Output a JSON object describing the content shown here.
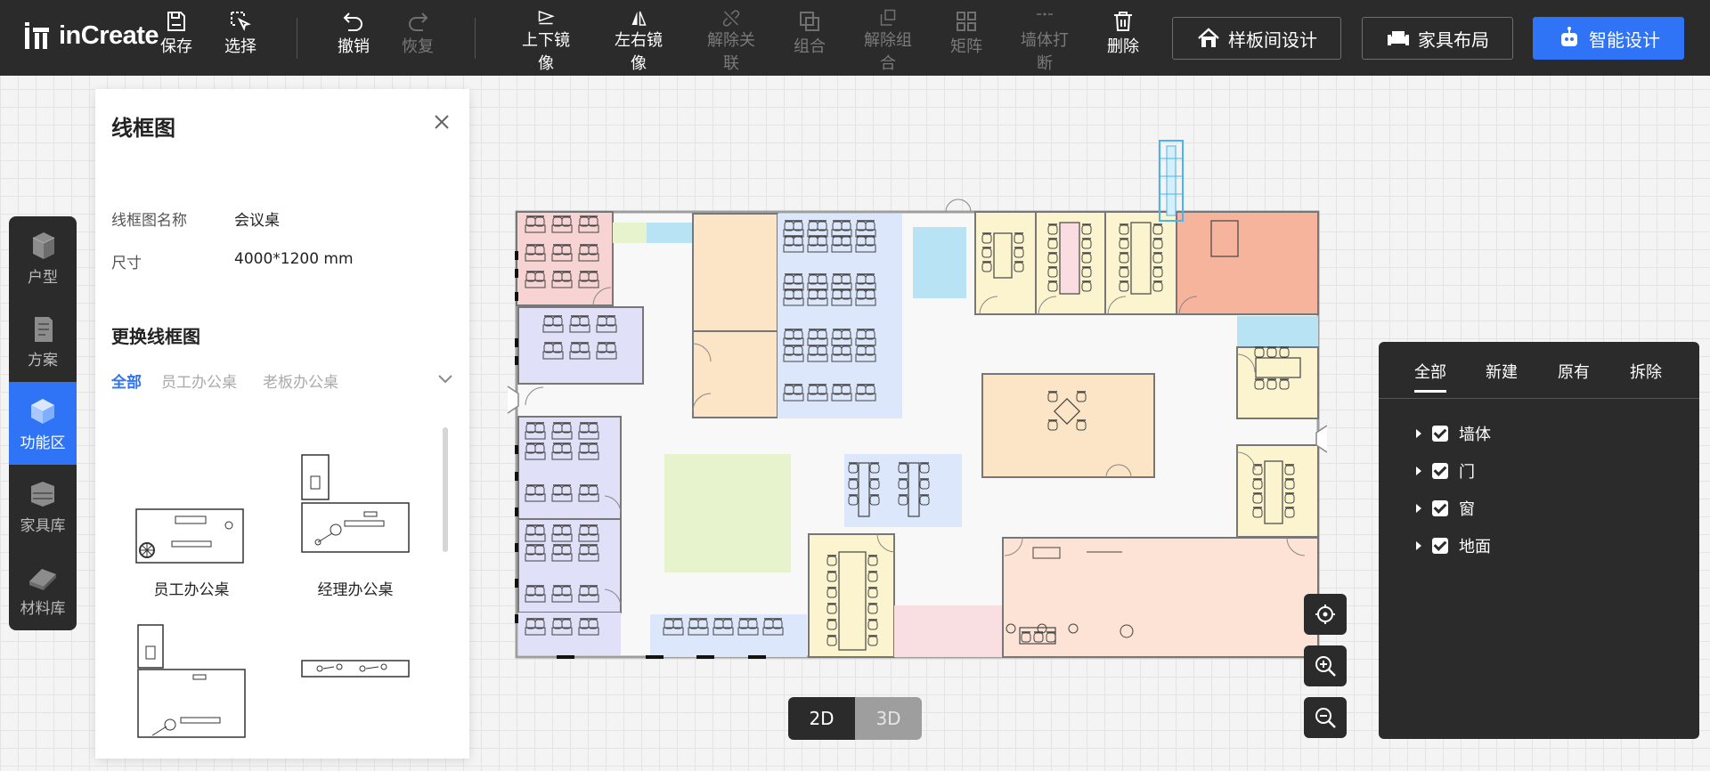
{
  "app": {
    "logo_text": "inCreate"
  },
  "toolbar": {
    "tools": [
      {
        "id": "save",
        "label": "保存",
        "enabled": true,
        "icon": "save-icon"
      },
      {
        "id": "select",
        "label": "选择",
        "enabled": true,
        "icon": "select-icon"
      },
      {
        "id": "undo",
        "label": "撤销",
        "enabled": true,
        "icon": "undo-icon"
      },
      {
        "id": "redo",
        "label": "恢复",
        "enabled": false,
        "icon": "redo-icon"
      },
      {
        "id": "flip-v",
        "label": "上下镜像",
        "enabled": true,
        "icon": "flip-vertical-icon"
      },
      {
        "id": "flip-h",
        "label": "左右镜像",
        "enabled": true,
        "icon": "flip-horizontal-icon"
      },
      {
        "id": "unlink",
        "label": "解除关联",
        "enabled": false,
        "icon": "unlink-icon"
      },
      {
        "id": "group",
        "label": "组合",
        "enabled": false,
        "icon": "group-icon"
      },
      {
        "id": "ungroup",
        "label": "解除组合",
        "enabled": false,
        "icon": "ungroup-icon"
      },
      {
        "id": "matrix",
        "label": "矩阵",
        "enabled": false,
        "icon": "matrix-icon"
      },
      {
        "id": "wall-break",
        "label": "墙体打断",
        "enabled": false,
        "icon": "wall-break-icon"
      },
      {
        "id": "delete",
        "label": "删除",
        "enabled": true,
        "icon": "trash-icon"
      }
    ],
    "buttons": {
      "showroom": "样板间设计",
      "furniture_layout": "家具布局",
      "smart_design": "智能设计"
    }
  },
  "leftnav": {
    "items": [
      {
        "label": "户型",
        "active": false,
        "icon": "house-type-icon"
      },
      {
        "label": "方案",
        "active": false,
        "icon": "plan-icon"
      },
      {
        "label": "功能区",
        "active": true,
        "icon": "function-zone-icon"
      },
      {
        "label": "家具库",
        "active": false,
        "icon": "furniture-library-icon"
      },
      {
        "label": "材料库",
        "active": false,
        "icon": "material-library-icon"
      }
    ]
  },
  "panel": {
    "title": "线框图",
    "name_label": "线框图名称",
    "name_value": "会议桌",
    "size_label": "尺寸",
    "size_value": "4000*1200 mm",
    "section_title": "更换线框图",
    "filters": [
      {
        "label": "全部",
        "active": true
      },
      {
        "label": "员工办公桌",
        "active": false
      },
      {
        "label": "老板办公桌",
        "active": false
      }
    ],
    "cards": [
      {
        "label": "员工办公桌",
        "icon": "staff-desk-icon"
      },
      {
        "label": "经理办公桌",
        "icon": "manager-desk-icon"
      },
      {
        "label": "",
        "icon": "executive-desk-icon"
      },
      {
        "label": "",
        "icon": "bench-desk-icon"
      }
    ]
  },
  "view": {
    "mode_2d": "2D",
    "mode_3d": "3D",
    "active": "2D"
  },
  "layers": {
    "tabs": [
      {
        "label": "全部",
        "active": true
      },
      {
        "label": "新建",
        "active": false
      },
      {
        "label": "原有",
        "active": false
      },
      {
        "label": "拆除",
        "active": false
      }
    ],
    "items": [
      {
        "label": "墙体",
        "checked": true
      },
      {
        "label": "门",
        "checked": true
      },
      {
        "label": "窗",
        "checked": true
      },
      {
        "label": "地面",
        "checked": true
      }
    ]
  },
  "colors": {
    "toolbar_bg": "#2b2b2b",
    "accent": "#2f73f6",
    "room_red": "#f7d3d3",
    "room_purple": "#e0e0f8",
    "room_yellow": "#fcf4cf",
    "room_orange": "#fbe5c6",
    "room_blue": "#dce7fb",
    "room_salmon": "#f7b49c",
    "room_cyan": "#b8e3f4",
    "room_green": "#e6f3cc",
    "room_peach": "#fde3d6"
  }
}
